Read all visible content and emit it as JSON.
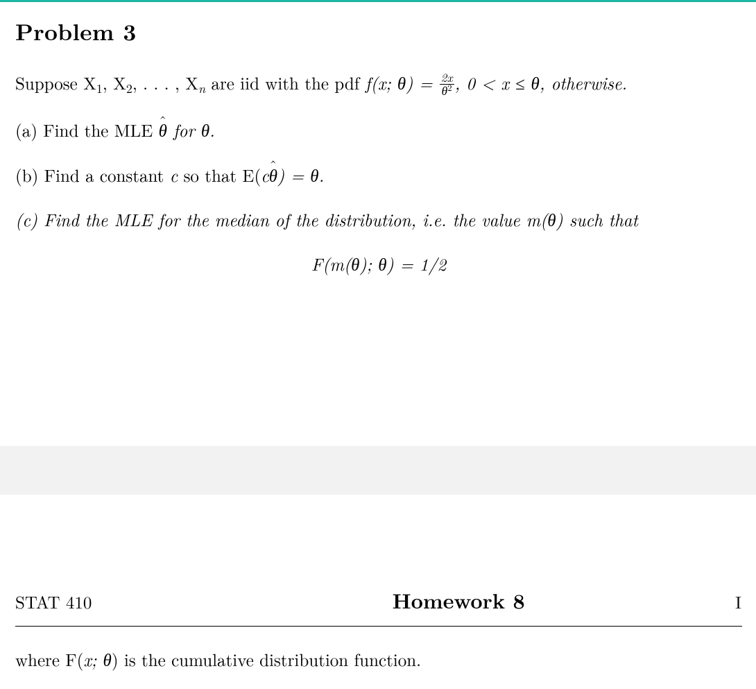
{
  "problem": {
    "title": "Problem 3",
    "intro_pre": "Suppose X",
    "intro_sub1": "1",
    "intro_mid1": ", X",
    "intro_sub2": "2",
    "intro_mid2": ", . . . , X",
    "intro_subn": "n",
    "intro_mid3": " are iid with the pdf ",
    "intro_fn": "f",
    "intro_fn_args": "(x; θ) = ",
    "frac_num": "2x",
    "frac_den": "θ",
    "frac_den_sup": "2",
    "intro_after_frac": ", 0 < x ≤ θ, otherwise.",
    "part_a_pre": "(a) Find the MLE ",
    "part_a_theta": "θ",
    "part_a_post": " for θ.",
    "part_b_pre": "(b) Find a constant ",
    "part_b_c": "c",
    "part_b_mid": " so that E(",
    "part_b_c2": "c",
    "part_b_theta": "θ",
    "part_b_post": ") = θ.",
    "part_c": "(c) Find the MLE for the median of the distribution, i.e. the value m(θ) such that",
    "eq_center": "F(m(θ); θ) = 1/2"
  },
  "footer": {
    "left": "STAT 410",
    "center": "Homework 8",
    "right_clip": "I"
  },
  "after": {
    "text_pre": "where F(",
    "text_args": "x; θ",
    "text_post": ") is the cumulative distribution function."
  }
}
